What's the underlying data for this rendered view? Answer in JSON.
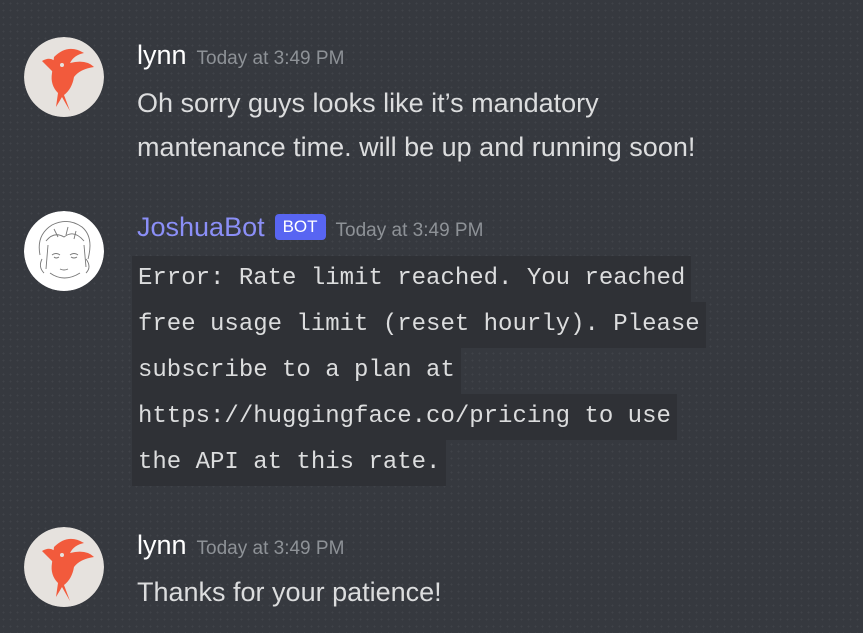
{
  "messages": [
    {
      "username": "lynn",
      "timestamp": "Today at 3:49 PM",
      "lines": [
        "Oh sorry guys looks like it’s mandatory",
        "mantenance time. will be up and running soon!"
      ]
    },
    {
      "username": "JoshuaBot",
      "badge": "BOT",
      "timestamp": "Today at 3:49 PM",
      "code_lines": [
        "Error: Rate limit reached. You reached",
        "free usage limit (reset hourly). Please",
        "subscribe to a plan at",
        "https://huggingface.co/pricing to use",
        "the API at this rate."
      ]
    },
    {
      "username": "lynn",
      "timestamp": "Today at 3:49 PM",
      "lines": [
        "Thanks for your patience!"
      ]
    }
  ],
  "colors": {
    "background": "#36393f",
    "code_background": "#2f3136",
    "bot_name": "#8b8ff7",
    "bot_badge": "#5865f2",
    "bird": "#f25a3c"
  }
}
